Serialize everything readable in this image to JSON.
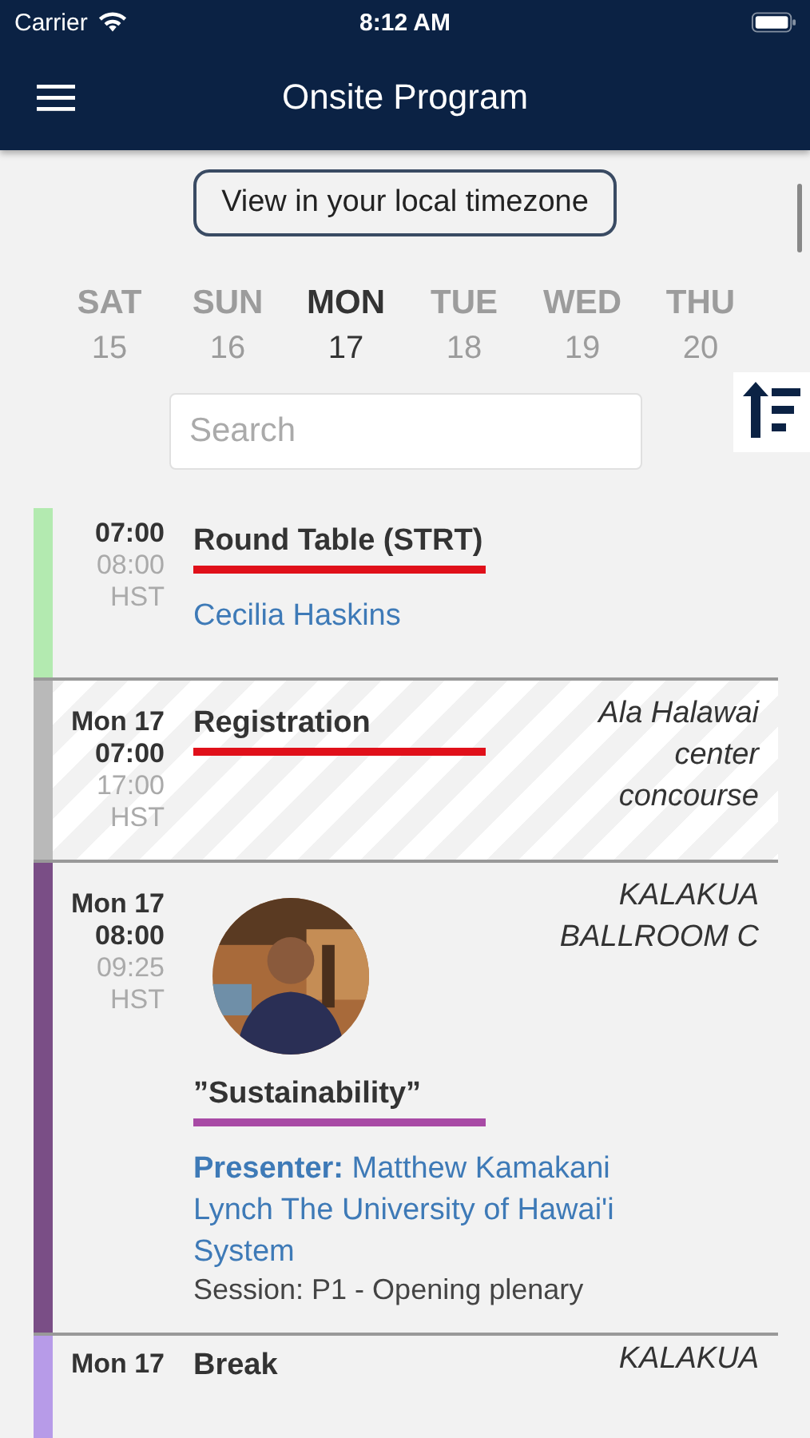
{
  "status_bar": {
    "carrier": "Carrier",
    "time": "8:12 AM"
  },
  "nav": {
    "title": "Onsite Program"
  },
  "timezone_button": "View in your local timezone",
  "days": [
    {
      "weekday": "SAT",
      "date": "15",
      "selected": false
    },
    {
      "weekday": "SUN",
      "date": "16",
      "selected": false
    },
    {
      "weekday": "MON",
      "date": "17",
      "selected": true
    },
    {
      "weekday": "TUE",
      "date": "18",
      "selected": false
    },
    {
      "weekday": "WED",
      "date": "19",
      "selected": false
    },
    {
      "weekday": "THU",
      "date": "20",
      "selected": false
    }
  ],
  "search": {
    "placeholder": "Search"
  },
  "events": [
    {
      "kind": "plain",
      "color": "#b3eab0",
      "start": "07:00",
      "end": "08:00",
      "tz": "HST",
      "title": "Round Table (STRT)",
      "underline": {
        "color": "#e0101a"
      },
      "people": "Cecilia Haskins"
    },
    {
      "kind": "striped",
      "color": "#b9b9b9",
      "date": "Mon 17",
      "start": "07:00",
      "end": "17:00",
      "tz": "HST",
      "title": "Registration",
      "underline": {
        "color": "#e0101a"
      },
      "location": "Ala Halawai center concourse"
    },
    {
      "kind": "plain",
      "color": "#7a4e86",
      "date": "Mon 17",
      "start": "08:00",
      "end": "09:25",
      "tz": "HST",
      "title": "”Sustainability”",
      "underline": {
        "color": "#a84aa5"
      },
      "people": "**Presenter:** Matthew Kamakani Lynch The University of Hawai'i System",
      "session": "Session: P1 - Opening plenary",
      "location": "KALAKUA BALLROOM C"
    },
    {
      "kind": "plain",
      "color": "#b79be8",
      "date": "Mon 17",
      "title": "Break",
      "location": "KALAKUA"
    }
  ]
}
